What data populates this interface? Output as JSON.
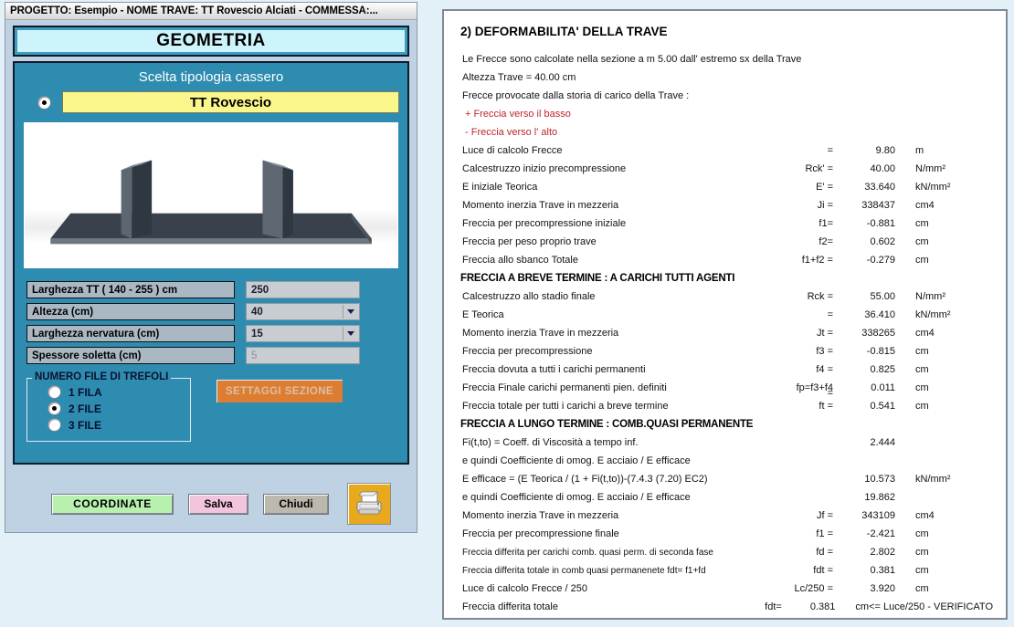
{
  "window": {
    "title": "PROGETTO: Esempio - NOME TRAVE: TT Rovescio Alciati - COMMESSA:..."
  },
  "geometry_panel": {
    "header": "GEOMETRIA",
    "group_caption": "Scelta tipologia cassero",
    "selected_type": "TT Rovescio",
    "fields": [
      {
        "label": "Larghezza TT ( 140 - 255 ) cm",
        "value": "250",
        "kind": "text",
        "disabled": false
      },
      {
        "label": "Altezza (cm)",
        "value": "40",
        "kind": "combo",
        "disabled": false
      },
      {
        "label": "Larghezza nervatura (cm)",
        "value": "15",
        "kind": "combo",
        "disabled": false
      },
      {
        "label": "Spessore soletta (cm)",
        "value": "5",
        "kind": "text",
        "disabled": true
      }
    ],
    "trefoli": {
      "legend": "NUMERO FILE DI TREFOLI",
      "options": [
        {
          "label": "1 FILA",
          "checked": false
        },
        {
          "label": "2 FILE",
          "checked": true
        },
        {
          "label": "3 FILE",
          "checked": false
        }
      ]
    },
    "settaggi_button": "SETTAGGI SEZIONE",
    "buttons": {
      "coordinate": "COORDINATE",
      "salva": "Salva",
      "chiudi": "Chiudi",
      "print_icon": "printer-icon"
    },
    "colors": {
      "panel_teal": "#2e8cb0",
      "header_cyan": "#cdf4fb",
      "value_yellow": "#fbf68c",
      "settaggi_orange": "#f57c20",
      "coordinate_green": "#b8f0b0",
      "salva_pink": "#f3c4dd",
      "chiudi_gray": "#bdb8ad",
      "print_gold": "#e8a91c"
    }
  },
  "report": {
    "title": "2) DEFORMABILITA' DELLA TRAVE",
    "intro": [
      {
        "text": "Le Frecce sono calcolate nella sezione a m 5.00 dall' estremo sx della Trave",
        "style": "plain"
      },
      {
        "text": "Altezza Trave  = 40.00 cm",
        "style": "plain"
      },
      {
        "text": "Frecce provocate dalla storia di carico della Trave :",
        "style": "plain"
      },
      {
        "text": "+  Freccia verso il basso",
        "style": "red"
      },
      {
        "text": "-  Freccia verso l' alto",
        "style": "red"
      }
    ],
    "blocks": [
      {
        "heading": null,
        "rows": [
          {
            "desc": "Luce di calcolo Frecce",
            "sym": "=",
            "val": "9.80",
            "unit": "m"
          },
          {
            "desc": "Calcestruzzo inizio precompressione",
            "sym": "Rck' =",
            "val": "40.00",
            "unit": "N/mm²"
          },
          {
            "desc": "E iniziale Teorica",
            "sym": "E' =",
            "val": "33.640",
            "unit": "kN/mm²"
          },
          {
            "desc": "Momento inerzia Trave in mezzeria",
            "sym": "Ji =",
            "val": "338437",
            "unit": "cm4"
          },
          {
            "desc": "Freccia per precompressione iniziale",
            "sym": "f1=",
            "val": "-0.881",
            "unit": "cm"
          },
          {
            "desc": "Freccia per peso proprio trave",
            "sym": "f2=",
            "val": "0.602",
            "unit": "cm"
          },
          {
            "desc": "Freccia  allo sbanco Totale",
            "sym": "f1+f2 =",
            "val": "-0.279",
            "unit": "cm"
          }
        ]
      },
      {
        "heading": "FRECCIA A BREVE TERMINE : A CARICHI TUTTI AGENTI",
        "rows": [
          {
            "desc": "Calcestruzzo allo stadio finale",
            "sym": "Rck =",
            "val": "55.00",
            "unit": "N/mm²"
          },
          {
            "desc": "E Teorica",
            "sym": "=",
            "val": "36.410",
            "unit": "kN/mm²"
          },
          {
            "desc": "Momento inerzia Trave in mezzeria",
            "sym": "Jt =",
            "val": "338265",
            "unit": "cm4"
          },
          {
            "desc": "Freccia per precompressione",
            "sym": "f3 =",
            "val": "-0.815",
            "unit": "cm"
          },
          {
            "desc": "Freccia dovuta a tutti i carichi permanenti",
            "sym": "f4 =",
            "val": "0.825",
            "unit": "cm"
          },
          {
            "desc": "Freccia  Finale carichi permanenti pien. definiti",
            "sym": "fp=f3+f4",
            "val": "0.011",
            "unit": "cm"
          },
          {
            "desc": "Freccia totale per tutti i carichi a breve termine",
            "sym": "ft =",
            "val": "0.541",
            "unit": "cm",
            "eq_above": "="
          }
        ]
      },
      {
        "heading": "FRECCIA A LUNGO TERMINE : COMB.QUASI PERMANENTE",
        "rows": [
          {
            "desc": "Fi(t,to) = Coeff. di Viscosità a tempo inf.",
            "sym": "",
            "val": "2.444",
            "unit": ""
          },
          {
            "desc": "e quindi Coefficiente di omog. E acciaio / E efficace",
            "sym": "",
            "val": "",
            "unit": ""
          },
          {
            "desc": "E efficace = (E Teorica / (1 + Fi(t,to))-(7.4.3 (7.20) EC2)",
            "sym": "",
            "val": "10.573",
            "unit": "kN/mm²"
          },
          {
            "desc": "e quindi Coefficiente di omog. E acciaio / E efficace",
            "sym": "",
            "val": "19.862",
            "unit": ""
          },
          {
            "desc": "Momento inerzia Trave in mezzeria",
            "sym": "Jf =",
            "val": "343109",
            "unit": "cm4"
          },
          {
            "desc": "Freccia per precompressione finale",
            "sym": "f1 =",
            "val": "-2.421",
            "unit": "cm"
          },
          {
            "desc": "Freccia differita per carichi  comb. quasi perm. di seconda fase",
            "sym": "fd =",
            "val": "2.802",
            "unit": "cm",
            "small": true
          },
          {
            "desc": "Freccia differita totale in comb quasi permanenete fdt= f1+fd",
            "sym": "fdt =",
            "val": "0.381",
            "unit": "cm",
            "small": true
          },
          {
            "desc": "Luce di calcolo Frecce / 250",
            "sym": "Lc/250 =",
            "val": "3.920",
            "unit": "cm"
          },
          {
            "desc": "Freccia differita totale",
            "sym": "fdt=",
            "val": "0.381",
            "unit": "cm<= Luce/250 - VERIFICATO"
          }
        ]
      }
    ]
  }
}
